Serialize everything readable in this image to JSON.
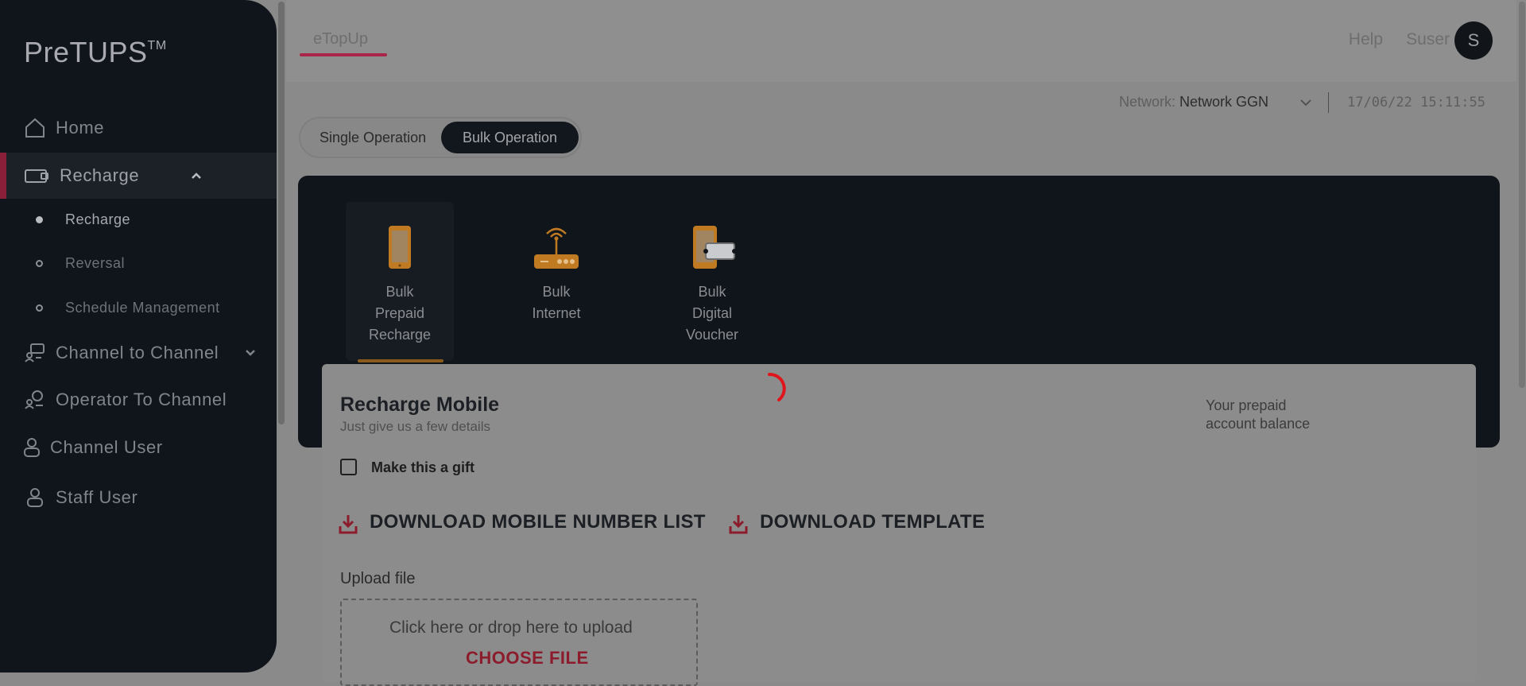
{
  "sidebar": {
    "brand": "PreTUPS",
    "brand_tm": "TM",
    "items": [
      {
        "label": "Home",
        "icon": "home-icon"
      },
      {
        "label": "Recharge",
        "icon": "recharge-icon"
      },
      {
        "label": "Channel to Channel",
        "icon": "channel-icon"
      },
      {
        "label": "Operator To Channel",
        "icon": "operator-icon"
      },
      {
        "label": "Channel User",
        "icon": "user-icon"
      },
      {
        "label": "Staff User",
        "icon": "user-icon"
      }
    ],
    "sub_items": [
      {
        "label": "Recharge"
      },
      {
        "label": "Reversal"
      },
      {
        "label": "Schedule Management"
      }
    ]
  },
  "header": {
    "tab": "eTopUp",
    "help": "Help",
    "user": "Suser",
    "avatar_initial": "S"
  },
  "network": {
    "label": "Network:",
    "value": "Network GGN",
    "datetime": "17/06/22 15:11:55"
  },
  "operation_toggle": {
    "single": "Single Operation",
    "bulk": "Bulk Operation",
    "selected": "Bulk Operation"
  },
  "products": [
    {
      "line1": "Bulk",
      "line2": "Prepaid",
      "line3": "Recharge",
      "icon": "mobile-icon"
    },
    {
      "line1": "Bulk",
      "line2": "Internet",
      "line3": "",
      "icon": "router-icon"
    },
    {
      "line1": "Bulk",
      "line2": "Digital",
      "line3": "Voucher",
      "icon": "voucher-icon"
    }
  ],
  "card": {
    "title": "Recharge Mobile",
    "subtitle": "Just give us a few details",
    "balance_line1": "Your prepaid",
    "balance_line2": "account balance",
    "gift_label": "Make this a gift",
    "download_list": "DOWNLOAD MOBILE NUMBER LIST",
    "download_template": "DOWNLOAD TEMPLATE",
    "upload_label": "Upload file",
    "drop_text": "Click here or drop here to upload",
    "choose_file": "CHOOSE FILE"
  },
  "colors": {
    "accent": "#a9254a",
    "sidebar_bg": "#10151b",
    "product_orange": "#c07a22",
    "download_red": "#8c1b2c",
    "spinner": "#e0151b"
  }
}
